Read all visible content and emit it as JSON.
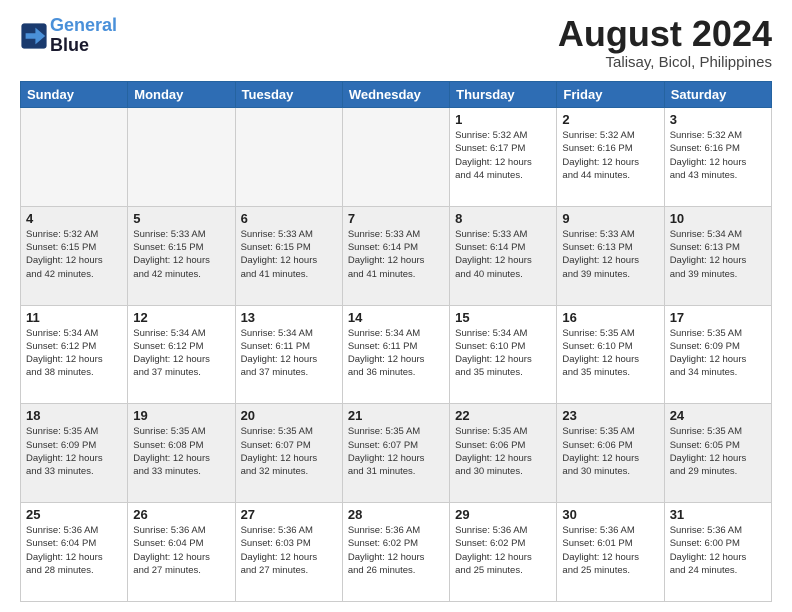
{
  "header": {
    "logo_line1": "General",
    "logo_line2": "Blue",
    "month_year": "August 2024",
    "location": "Talisay, Bicol, Philippines"
  },
  "days_of_week": [
    "Sunday",
    "Monday",
    "Tuesday",
    "Wednesday",
    "Thursday",
    "Friday",
    "Saturday"
  ],
  "weeks": [
    [
      {
        "day": "",
        "info": "",
        "empty": true
      },
      {
        "day": "",
        "info": "",
        "empty": true
      },
      {
        "day": "",
        "info": "",
        "empty": true
      },
      {
        "day": "",
        "info": "",
        "empty": true
      },
      {
        "day": "1",
        "info": "Sunrise: 5:32 AM\nSunset: 6:17 PM\nDaylight: 12 hours\nand 44 minutes."
      },
      {
        "day": "2",
        "info": "Sunrise: 5:32 AM\nSunset: 6:16 PM\nDaylight: 12 hours\nand 44 minutes."
      },
      {
        "day": "3",
        "info": "Sunrise: 5:32 AM\nSunset: 6:16 PM\nDaylight: 12 hours\nand 43 minutes."
      }
    ],
    [
      {
        "day": "4",
        "info": "Sunrise: 5:32 AM\nSunset: 6:15 PM\nDaylight: 12 hours\nand 42 minutes."
      },
      {
        "day": "5",
        "info": "Sunrise: 5:33 AM\nSunset: 6:15 PM\nDaylight: 12 hours\nand 42 minutes."
      },
      {
        "day": "6",
        "info": "Sunrise: 5:33 AM\nSunset: 6:15 PM\nDaylight: 12 hours\nand 41 minutes."
      },
      {
        "day": "7",
        "info": "Sunrise: 5:33 AM\nSunset: 6:14 PM\nDaylight: 12 hours\nand 41 minutes."
      },
      {
        "day": "8",
        "info": "Sunrise: 5:33 AM\nSunset: 6:14 PM\nDaylight: 12 hours\nand 40 minutes."
      },
      {
        "day": "9",
        "info": "Sunrise: 5:33 AM\nSunset: 6:13 PM\nDaylight: 12 hours\nand 39 minutes."
      },
      {
        "day": "10",
        "info": "Sunrise: 5:34 AM\nSunset: 6:13 PM\nDaylight: 12 hours\nand 39 minutes."
      }
    ],
    [
      {
        "day": "11",
        "info": "Sunrise: 5:34 AM\nSunset: 6:12 PM\nDaylight: 12 hours\nand 38 minutes."
      },
      {
        "day": "12",
        "info": "Sunrise: 5:34 AM\nSunset: 6:12 PM\nDaylight: 12 hours\nand 37 minutes."
      },
      {
        "day": "13",
        "info": "Sunrise: 5:34 AM\nSunset: 6:11 PM\nDaylight: 12 hours\nand 37 minutes."
      },
      {
        "day": "14",
        "info": "Sunrise: 5:34 AM\nSunset: 6:11 PM\nDaylight: 12 hours\nand 36 minutes."
      },
      {
        "day": "15",
        "info": "Sunrise: 5:34 AM\nSunset: 6:10 PM\nDaylight: 12 hours\nand 35 minutes."
      },
      {
        "day": "16",
        "info": "Sunrise: 5:35 AM\nSunset: 6:10 PM\nDaylight: 12 hours\nand 35 minutes."
      },
      {
        "day": "17",
        "info": "Sunrise: 5:35 AM\nSunset: 6:09 PM\nDaylight: 12 hours\nand 34 minutes."
      }
    ],
    [
      {
        "day": "18",
        "info": "Sunrise: 5:35 AM\nSunset: 6:09 PM\nDaylight: 12 hours\nand 33 minutes."
      },
      {
        "day": "19",
        "info": "Sunrise: 5:35 AM\nSunset: 6:08 PM\nDaylight: 12 hours\nand 33 minutes."
      },
      {
        "day": "20",
        "info": "Sunrise: 5:35 AM\nSunset: 6:07 PM\nDaylight: 12 hours\nand 32 minutes."
      },
      {
        "day": "21",
        "info": "Sunrise: 5:35 AM\nSunset: 6:07 PM\nDaylight: 12 hours\nand 31 minutes."
      },
      {
        "day": "22",
        "info": "Sunrise: 5:35 AM\nSunset: 6:06 PM\nDaylight: 12 hours\nand 30 minutes."
      },
      {
        "day": "23",
        "info": "Sunrise: 5:35 AM\nSunset: 6:06 PM\nDaylight: 12 hours\nand 30 minutes."
      },
      {
        "day": "24",
        "info": "Sunrise: 5:35 AM\nSunset: 6:05 PM\nDaylight: 12 hours\nand 29 minutes."
      }
    ],
    [
      {
        "day": "25",
        "info": "Sunrise: 5:36 AM\nSunset: 6:04 PM\nDaylight: 12 hours\nand 28 minutes."
      },
      {
        "day": "26",
        "info": "Sunrise: 5:36 AM\nSunset: 6:04 PM\nDaylight: 12 hours\nand 27 minutes."
      },
      {
        "day": "27",
        "info": "Sunrise: 5:36 AM\nSunset: 6:03 PM\nDaylight: 12 hours\nand 27 minutes."
      },
      {
        "day": "28",
        "info": "Sunrise: 5:36 AM\nSunset: 6:02 PM\nDaylight: 12 hours\nand 26 minutes."
      },
      {
        "day": "29",
        "info": "Sunrise: 5:36 AM\nSunset: 6:02 PM\nDaylight: 12 hours\nand 25 minutes."
      },
      {
        "day": "30",
        "info": "Sunrise: 5:36 AM\nSunset: 6:01 PM\nDaylight: 12 hours\nand 25 minutes."
      },
      {
        "day": "31",
        "info": "Sunrise: 5:36 AM\nSunset: 6:00 PM\nDaylight: 12 hours\nand 24 minutes."
      }
    ]
  ]
}
